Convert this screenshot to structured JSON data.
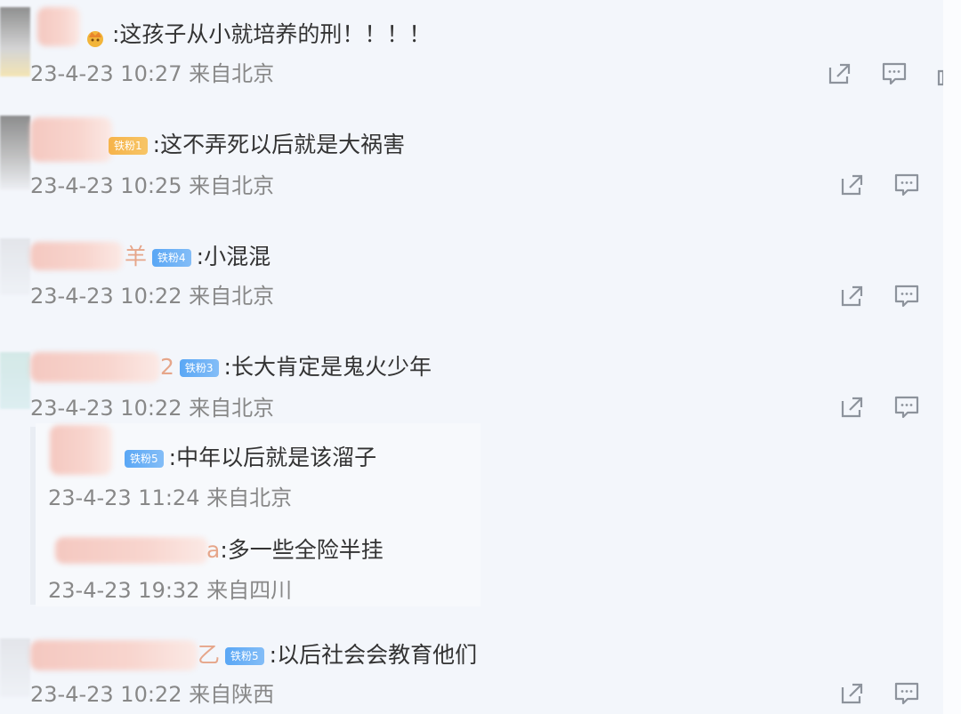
{
  "comments": [
    {
      "name_tail": "",
      "badge": "",
      "text": ":这孩子从小就培养的刑！！！！",
      "meta": "23-4-23 10:27 来自北京"
    },
    {
      "name_tail": "",
      "badge": "铁粉1",
      "text": ":这不弄死以后就是大祸害",
      "meta": "23-4-23 10:25 来自北京"
    },
    {
      "name_tail": "羊",
      "badge": "铁粉4",
      "text": ":小混混",
      "meta": "23-4-23 10:22 来自北京"
    },
    {
      "name_tail": "2",
      "badge": "铁粉3",
      "text": ":长大肯定是鬼火少年",
      "meta": "23-4-23 10:22 来自北京"
    },
    {
      "name_tail": "乙",
      "badge": "铁粉5",
      "text": ":以后社会会教育他们",
      "meta": "23-4-23 10:22 来自陕西"
    }
  ],
  "replies": [
    {
      "name_tail": "",
      "badge": "铁粉5",
      "text": ":中年以后就是该溜子",
      "meta": "23-4-23 11:24 来自北京"
    },
    {
      "name_tail": "a",
      "badge": "",
      "text": ":多一些全险半挂",
      "meta": "23-4-23 19:32 来自四川"
    }
  ],
  "icons": [
    "share-icon",
    "comment-icon"
  ]
}
